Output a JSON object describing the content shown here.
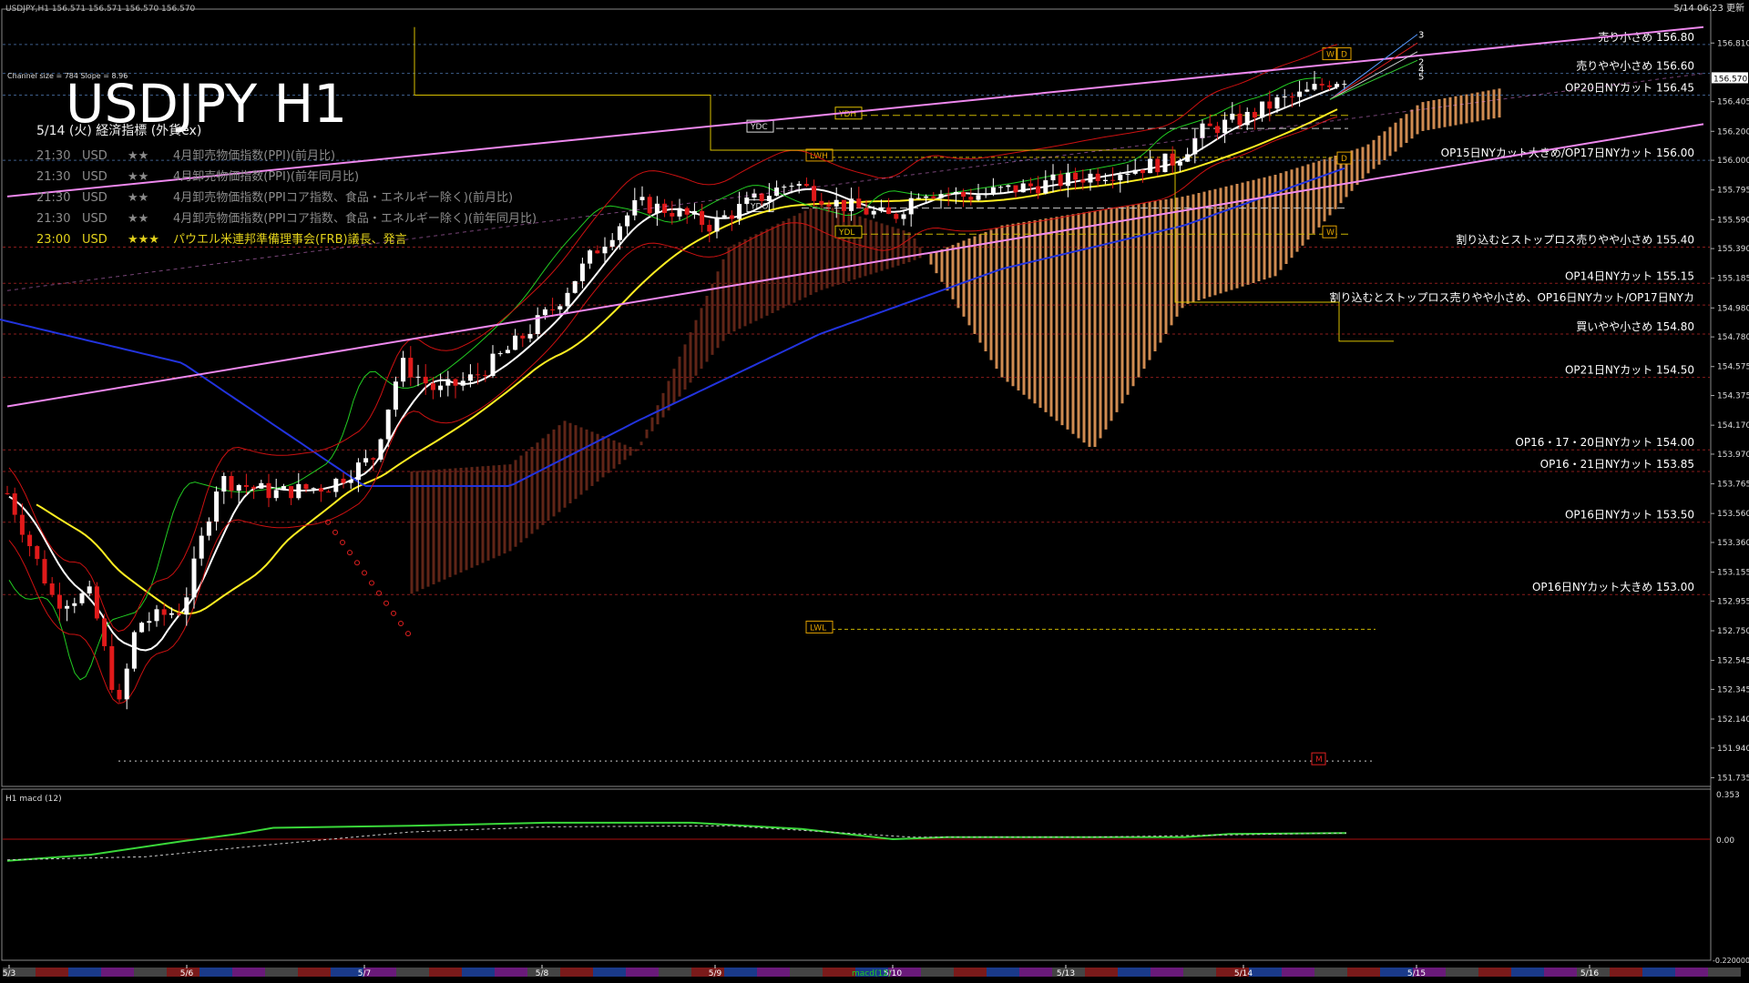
{
  "window": {
    "header": "USDJPY,H1  156.571 156.571 156.570 156.570",
    "channel_info": "Channel size = 784 Slope = 8.96",
    "updated": "5/14 06:23 更新",
    "big_title": "USDJPY H1"
  },
  "calendar": {
    "heading": "5/14 (火) 経済指標 (外貨ex)",
    "events": [
      {
        "time": "21:30",
        "ccy": "USD",
        "stars": "★★",
        "text": "4月卸売物価指数(PPI)(前月比)",
        "color": "#8c8c8c"
      },
      {
        "time": "21:30",
        "ccy": "USD",
        "stars": "★★",
        "text": "4月卸売物価指数(PPI)(前年同月比)",
        "color": "#8c8c8c"
      },
      {
        "time": "21:30",
        "ccy": "USD",
        "stars": "★★",
        "text": "4月卸売物価指数(PPIコア指数、食品・エネルギー除く)(前月比)",
        "color": "#8c8c8c"
      },
      {
        "time": "21:30",
        "ccy": "USD",
        "stars": "★★",
        "text": "4月卸売物価指数(PPIコア指数、食品・エネルギー除く)(前年同月比)",
        "color": "#8c8c8c"
      },
      {
        "time": "23:00",
        "ccy": "USD",
        "stars": "★★★",
        "text": "パウエル米連邦準備理事会(FRB)議長、発言",
        "color": "#e3d21c"
      }
    ]
  },
  "price_axis": [
    "156.810",
    "156.405",
    "156.200",
    "156.000",
    "155.795",
    "155.590",
    "155.390",
    "155.185",
    "154.980",
    "154.780",
    "154.575",
    "154.375",
    "154.170",
    "153.970",
    "153.765",
    "153.560",
    "153.360",
    "153.155",
    "152.955",
    "152.750",
    "152.545",
    "152.345",
    "152.140",
    "151.940",
    "151.735"
  ],
  "current_price": "156.570",
  "order_levels": [
    {
      "label": "売り小さめ 156.80",
      "price": 156.8
    },
    {
      "label": "売りやや小さめ 156.60",
      "price": 156.6
    },
    {
      "label": "OP20日NYカット 156.45",
      "price": 156.45
    },
    {
      "label": "OP15日NYカット大きめ/OP17日NYカット 156.00",
      "price": 156.0
    },
    {
      "label": "割り込むとストップロス売りやや小さめ 155.40",
      "price": 155.4
    },
    {
      "label": "OP14日NYカット 155.15",
      "price": 155.15
    },
    {
      "label": "割り込むとストップロス売りやや小さめ、OP16日NYカット/OP17日NYカ",
      "price": 155.0
    },
    {
      "label": "買いやや小さめ 154.80",
      "price": 154.8
    },
    {
      "label": "OP21日NYカット 154.50",
      "price": 154.5
    },
    {
      "label": "OP16・17・20日NYカット 154.00",
      "price": 154.0
    },
    {
      "label": "OP16・21日NYカット 153.85",
      "price": 153.85
    },
    {
      "label": "OP16日NYカット 153.50",
      "price": 153.5
    },
    {
      "label": "OP16日NYカット大きめ 153.00",
      "price": 153.0
    }
  ],
  "markers": {
    "ydh": "YDH",
    "ydc": "YDC",
    "ydo": "YDO",
    "ydl": "YDL",
    "lwh": "LWH",
    "lwl": "LWL",
    "w": "W",
    "d": "D",
    "m": "M",
    "channel_lines": [
      "3",
      "2",
      "4",
      "5"
    ]
  },
  "macd": {
    "label": "H1  macd (12)",
    "axis_top": "0.353",
    "axis_zero": "0.00",
    "axis_bottom": "-0.220000"
  },
  "time_axis": [
    "5/3",
    "5/6",
    "5/7",
    "5/8",
    "5/9",
    "5/10",
    "5/13",
    "5/14",
    "5/15",
    "5/16"
  ],
  "time_axis_caption": "macd(12)",
  "colors": {
    "bull": "#ffffff",
    "bear": "#e01a1a",
    "fast_ma": "#ffffff",
    "mid_ma": "#ffee22",
    "slow_ma": "#2233dd",
    "channel": "#ee88ee",
    "kumo": "#f4a460",
    "green": "#22cc22"
  },
  "chart_data": {
    "type": "candlestick",
    "symbol": "USDJPY",
    "timeframe": "H1",
    "ylim": [
      151.7,
      156.95
    ],
    "x": [
      "5/3",
      "5/6",
      "5/7",
      "5/8",
      "5/9",
      "5/10",
      "5/13",
      "5/14"
    ],
    "close_approx": [
      152.9,
      153.7,
      154.4,
      155.4,
      155.8,
      155.7,
      156.2,
      156.57
    ],
    "macd": {
      "ylim": [
        -0.22,
        0.353
      ]
    }
  }
}
